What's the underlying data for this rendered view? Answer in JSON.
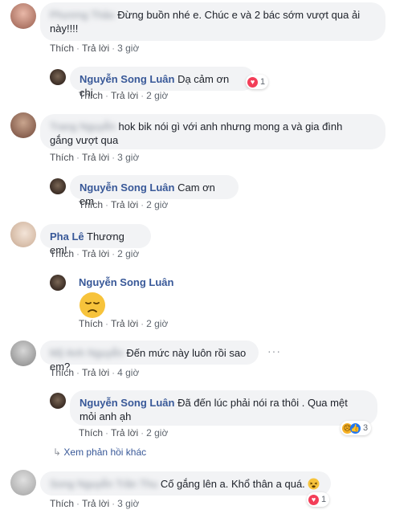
{
  "actions": {
    "like": "Thích",
    "reply": "Trả lời",
    "sep": "·"
  },
  "comments": [
    {
      "author": "Phương Thảo",
      "text_line1": "Đừng buồn nhé e. Chúc e và 2 bác sớm vượt qua ải",
      "text_line2": "này!!!!",
      "time": "3 giờ"
    },
    {
      "author": "Nguyễn Song Luân",
      "text": "Dạ cảm ơn chị",
      "time": "2 giờ",
      "reaction_count": "1"
    },
    {
      "author": "Trang Nguyễn",
      "text_line1": "hok bik nói gì với anh nhưng mong a và gia đình",
      "text_line2": "gắng vượt qua",
      "time": "3 giờ"
    },
    {
      "author": "Nguyễn Song Luân",
      "text": "Cam ơn em",
      "time": "2 giờ"
    },
    {
      "author": "Pha Lê",
      "text": "Thương em!",
      "time": "2 giờ"
    },
    {
      "author": "Nguyễn Song Luân",
      "time": "2 giờ",
      "emoji": "sad-face"
    },
    {
      "author": "Mỹ Anh Nguyễn",
      "text": "Đến mức này luôn rồi sao em?",
      "time": "4 giờ"
    },
    {
      "author": "Nguyễn Song Luân",
      "text_line1": "Đã đến lúc phải nói ra thôi . Qua mệt",
      "text_line2": "mỏi anh ạh",
      "time": "2 giờ",
      "reaction_count": "3"
    },
    {
      "author": "Song Nguyễn Trần Thu",
      "text": "Cố gắng lên a. Khổ thân a quá.",
      "time": "3 giờ",
      "reaction_count": "1"
    }
  ],
  "view_more_replies": "Xem phản hồi khác",
  "colors": {
    "name": "#385898",
    "bubble": "#f2f3f5",
    "heart": "#f33e58",
    "like": "#2078f4"
  }
}
